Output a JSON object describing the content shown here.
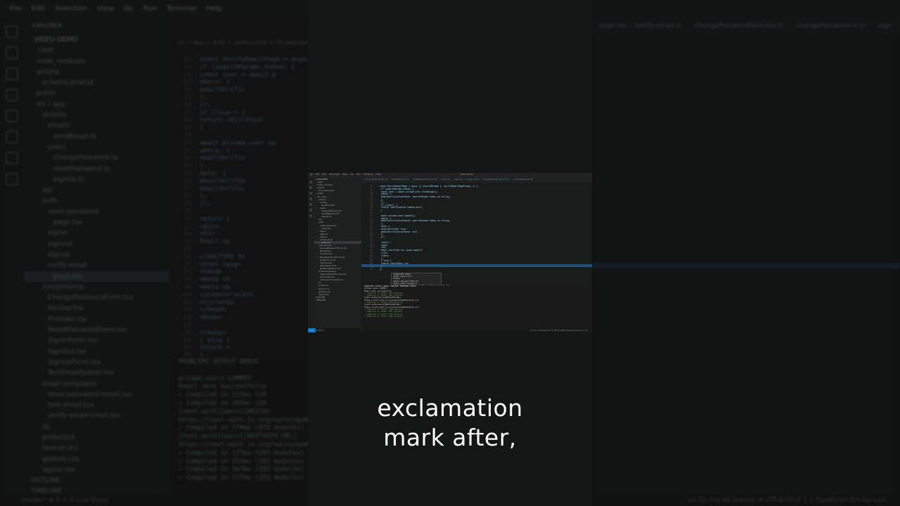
{
  "caption": {
    "line1": "exclamation",
    "line2": "mark after,"
  },
  "bg_menu": [
    "File",
    "Edit",
    "Selection",
    "View",
    "Go",
    "Run",
    "Terminal",
    "Help"
  ],
  "bg_explorer": {
    "header": "EXPLORER",
    "root": "VIDEO-DEMO",
    "items": [
      ".next",
      "node_modules",
      "prisma",
      "schema.prisma",
      "public",
      "src / app",
      "actions",
      "emails",
      "sendEmail.ts",
      "users",
      "changePassword.ts",
      "resetPassword.ts",
      "signUp.ts",
      "api",
      "auth",
      "reset-password",
      "page.tsx",
      "signin",
      "signout",
      "signup",
      "verify-email",
      "page.tsx",
      "components",
      "ChangePasswordForm.tsx",
      "Navbar.tsx",
      "Provider.tsx",
      "ResetPasswordForm.tsx",
      "SignInForm.tsx",
      "SignOut.tsx",
      "SignUpForm.tsx",
      "TestEmailButton.tsx",
      "email-templates",
      "reset-password-email.tsx",
      "test-email.tsx",
      "verify-email-email.tsx",
      "lib",
      "protected",
      "favicon.ico",
      "globals.css",
      "layout.tsx",
      "OUTLINE",
      "TIMELINE"
    ]
  },
  "bg_code": {
    "breadcrumb": "src > app > auth > verify-email > TS page.tsx",
    "line_start": 10,
    "lines": [
      "const VerifyEmailPage = async",
      "  if (searchParams.token) {",
      "    const user = await p",
      "      where: {",
      "        emailVerific",
      "      },",
      "    });",
      "    if (!user) {",
      "      return <div>Inval",
      "    }",
      "",
      "    await prisma.user.up",
      "      where: {",
      "        emailVerific",
      "      },",
      "      data: {",
      "        emailVerifie",
      "        emailVerific",
      "      },",
      "    });",
      "",
      "    return (",
      "      <div>",
      "        <h1>",
      "          Email ve",
      "",
      "        <!DOCTYPE ht",
      "        <html lang=",
      "        <head>",
      "          <meta ch",
      "          <meta na",
      "          content=\"width",
      "          <title>Do",
      "        </head>",
      "        <body>",
      "",
      "        </body>",
      "  } else {",
      "    return <",
      "  }",
      "};"
    ]
  },
  "bg_terminal": [
    "PROBLEMS   OUTPUT   DEBUG",
    "",
    "prisma.users COMMIT",
    "Email sent successfully",
    " ✓ Compiled in 215ms (28",
    " ✓ Compiled in 205ms (28",
    "[next-auth][warn][NEXTAU",
    "https://next-auth.js.org/warnings#next",
    " ✓ Compiled in 770ms (973 modules)",
    "[next-auth][warn][NEXTAUTH_URL]",
    "https://next-auth.js.org/warnings#next",
    " ✓ Compiled in 127ms (283 modules)",
    " ✓ Compiled in 153ms (283 modules)",
    " ✓ Compiled in 167ms (283 modules)",
    " ✓ Compiled in 137ms (283 modules)"
  ],
  "bg_tabs": [
    "page.tsx .../verify-email U",
    "ChangePasswordForm.tsx U",
    "changePassword.ts U",
    "sign"
  ],
  "bg_status": {
    "left": "master*  ⊗ 0 ⚠ 0   Live Share",
    "right": "Ln 32, Col 88   Spaces: 4   UTF-8   CRLF   { } TypeScript JSX   Go Live"
  },
  "mini": {
    "title": "video-demo",
    "menu": [
      "File",
      "Edit",
      "Selection",
      "View",
      "Go",
      "Run",
      "Terminal",
      "Help"
    ],
    "tabs": [
      "verify-email-email.tsx",
      "resetPassword.ts",
      "ResetPasswordForm.tsx",
      "page.tsx",
      "page.tsx .../verify-email",
      "ChangePasswordForm.tsx",
      "changePassword.ts"
    ],
    "code_lines": [
      "const VerifyEmailPage = async ({ searchParams }: VerifyEmailPageProps) => {",
      "  if (searchParams.token) {",
      "    const user = await prisma.user.findUnique({",
      "      where: {",
      "        emailVerificationToken: searchParams.token as string,",
      "      },",
      "    });",
      "    if (!user) {",
      "      return <div>Invalid token</div>;",
      "    }",
      "",
      "    await prisma.user.update({",
      "      where: {",
      "        emailVerificationToken: searchParams.token as string,",
      "      },",
      "      data: {",
      "        emailVerified: true,",
      "        emailVerificationToken: null",
      "      },",
      "    });",
      "",
      "    return (",
      "      <div>",
      "        <h1>",
      "          Email verified for {user.email}!",
      "        </h1>",
      "      </div>",
      "    );",
      "  } else {",
      "    return <div>Email not",
      "  }",
      "};"
    ],
    "popup": [
      "<!DOCTYPE html>",
      "<html lang=\"en\">",
      "<head>",
      "  <meta charset=\"UTF-8\">",
      "  <meta name=\"viewport\"",
      "  content=\"width=device-width, initial-scale=1.0\">",
      "  <title>Document</title>",
      "</head>",
      "<body>"
    ],
    "terminal": [
      "PROBLEMS   OUTPUT   DEBUG CONSOLE   TERMINAL   PORTS",
      "prisma.users COMMIT",
      "Email sent successfully",
      " ✓ Compiled in 215ms (283 modules)",
      " ✓ Compiled in 205ms (283 modules)",
      "[next-auth][warn][NEXTAUTH_URL]",
      "https://next-auth.js.org/warnings#nextauth_url",
      " ✓ Compiled in 770ms (973 modules)",
      "[next-auth][warn][NEXTAUTH_URL]",
      "https://next-auth.js.org/warnings#nextauth_url",
      " ✓ Compiled in 127ms (283 modules)",
      " ✓ Compiled in 153ms (283 modules)",
      " ✓ Compiled in 167ms (283 modules)",
      " ✓ Compiled in 137ms (283 modules)"
    ],
    "status_branch": "master*",
    "status_right": "Ln 32, Col 88   Spaces: 4   UTF-8   CRLF   TypeScript JSX   Go Live"
  }
}
